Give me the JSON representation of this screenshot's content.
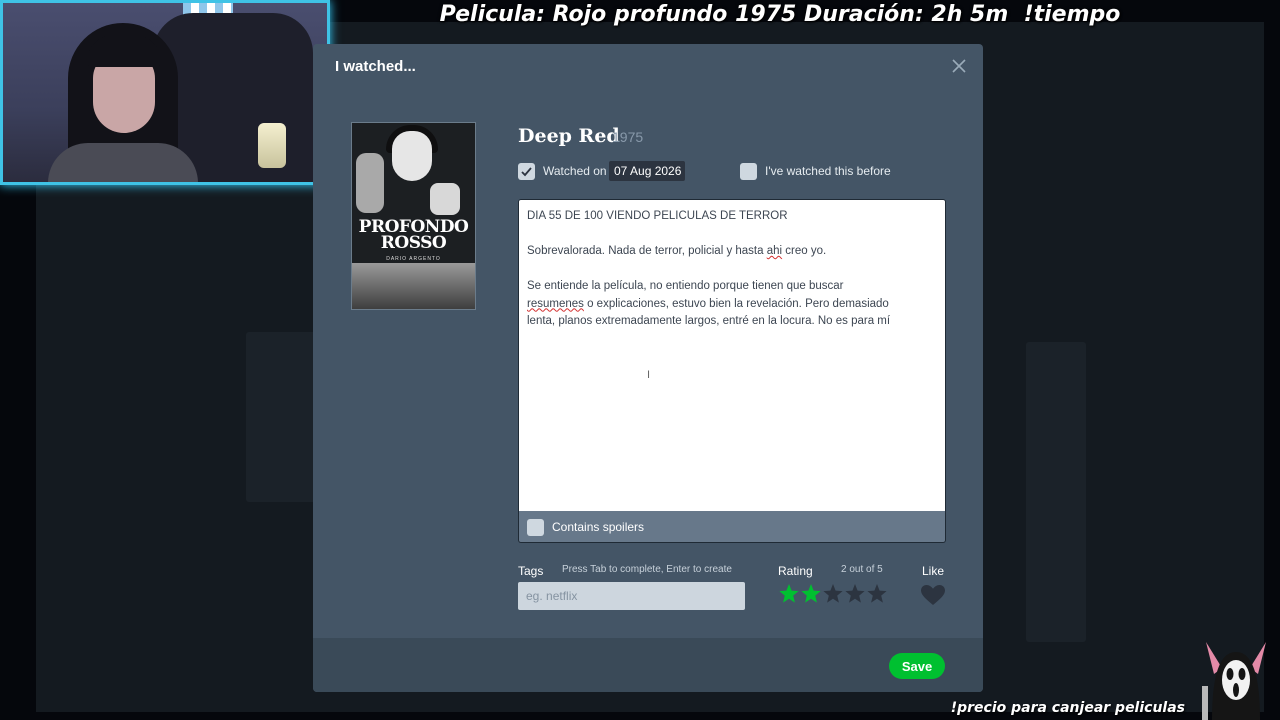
{
  "stream": {
    "title": "Pelicula: Rojo profundo 1975 Duración: 2h 5m  !tiempo",
    "footer": "!precio para canjear peliculas"
  },
  "modal": {
    "title": "I watched...",
    "film": {
      "title": "Deep Red",
      "year": "1975"
    },
    "poster": {
      "title_line1": "PROFONDO",
      "title_line2": "ROSSO",
      "director": "DARIO ARGENTO"
    },
    "watched_on": {
      "label": "Watched on",
      "checked": true,
      "date": "07 Aug 2026"
    },
    "rewatch": {
      "label": "I've watched this before",
      "checked": false
    },
    "review": {
      "line1": "DIA 55 DE 100 VIENDO PELICULAS DE TERROR",
      "line2_before": "Sobrevalorada. Nada de terror, policial y hasta ",
      "line2_misspelled": "ahi",
      "line2_after": " creo yo.",
      "line3_start": "Se entiende la película, no entiendo porque tienen que buscar",
      "line4_misspelled": "resumenes",
      "line4_after": " o explicaciones, estuvo bien la revelación. Pero demasiado",
      "line5": "lenta, planos extremadamente largos, entré en la locura. No es para mí"
    },
    "spoilers": {
      "label": "Contains spoilers",
      "checked": false
    },
    "tags": {
      "label": "Tags",
      "hint": "Press Tab to complete, Enter to create",
      "placeholder": "eg. netflix"
    },
    "rating": {
      "label": "Rating",
      "value_text": "2 out of 5",
      "value": 2,
      "max": 5
    },
    "like": {
      "label": "Like",
      "liked": false
    },
    "save_label": "Save"
  },
  "colors": {
    "modal_bg": "#445566",
    "star_active": "#00c030",
    "star_inactive": "#2c3440",
    "save_button": "#00c030"
  }
}
